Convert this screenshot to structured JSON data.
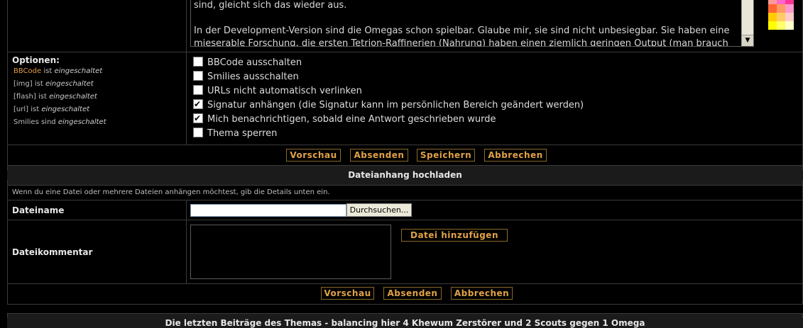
{
  "message": {
    "line1": "sind, gleicht sich das wieder aus.",
    "line2": "In der Development-Version sind die Omegas schon spielbar. Glaube mir, sie sind nicht unbesiegbar. Sie haben eine",
    "line3": "mieserable Forschung, die ersten Tetrion-Raffinerien (Nahrung) haben einen ziemlich geringen Output (man brauch",
    "scroll_arrow": "▼"
  },
  "palette_colors": [
    "#ff9999",
    "#ff66cc",
    "#ff3399",
    "#ff6633",
    "#ff9966",
    "#ff99cc",
    "#ffcc00",
    "#ffcc66",
    "#ffcccc",
    "#ffff00",
    "#ffff66",
    "#ffffcc"
  ],
  "options": {
    "title": "Optionen:",
    "bbcode_name": "BBCode",
    "bbcode_state": "eingeschaltet",
    "img_name": "[img]",
    "img_state": "eingeschaltet",
    "flash_name": "[flash]",
    "flash_state": "eingeschaltet",
    "url_name": "[url]",
    "url_state": "eingeschaltet",
    "smilies_name": "Smilies sind",
    "smilies_state": "eingeschaltet",
    "ist": "ist",
    "checkboxes": [
      {
        "label": "BBCode ausschalten",
        "checked": false
      },
      {
        "label": "Smilies ausschalten",
        "checked": false
      },
      {
        "label": "URLs nicht automatisch verlinken",
        "checked": false
      },
      {
        "label": "Signatur anhängen (die Signatur kann im persönlichen Bereich geändert werden)",
        "checked": true
      },
      {
        "label": "Mich benachrichtigen, sobald eine Antwort geschrieben wurde",
        "checked": true
      },
      {
        "label": "Thema sperren",
        "checked": false
      }
    ]
  },
  "buttons1": {
    "preview": "Vorschau",
    "submit": "Absenden",
    "save": "Speichern",
    "cancel": "Abbrechen"
  },
  "attachment": {
    "header": "Dateianhang hochladen",
    "info": "Wenn du eine Datei oder mehrere Dateien anhängen möchtest, gib die Details unten ein.",
    "filename_label": "Dateiname",
    "filename_value": "",
    "browse_label": "Durchsuchen...",
    "comment_label": "Dateikommentar",
    "add_file_label": "Datei hinzufügen"
  },
  "buttons2": {
    "preview": "Vorschau",
    "submit": "Absenden",
    "cancel": "Abbrechen"
  },
  "bottom": {
    "text": "Die letzten Beiträge des Themas - balancing hier 4 Khewum Zerstörer und 2 Scouts gegen 1 Omega"
  }
}
